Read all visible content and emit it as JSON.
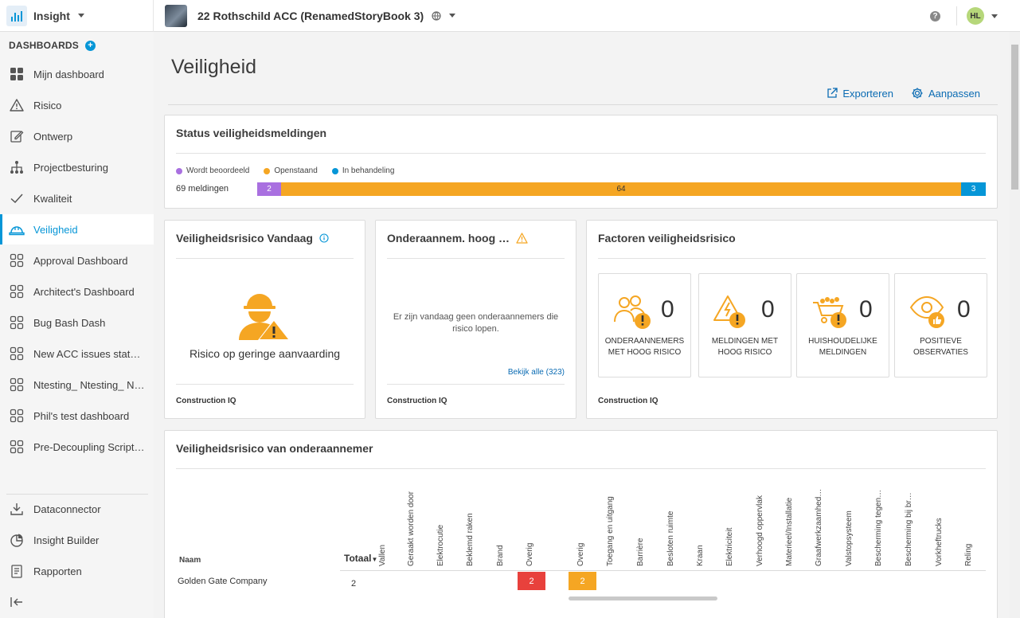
{
  "app": {
    "name": "Insight"
  },
  "project": {
    "name": "22 Rothschild ACC (RenamedStoryBook 3)"
  },
  "user": {
    "initials": "HL"
  },
  "sidebar": {
    "header": "DASHBOARDS",
    "items": [
      {
        "label": "Mijn dashboard"
      },
      {
        "label": "Risico"
      },
      {
        "label": "Ontwerp"
      },
      {
        "label": "Projectbesturing"
      },
      {
        "label": "Kwaliteit"
      },
      {
        "label": "Veiligheid"
      },
      {
        "label": "Approval Dashboard"
      },
      {
        "label": "Architect's Dashboard"
      },
      {
        "label": "Bug Bash Dash"
      },
      {
        "label": "New ACC issues status…"
      },
      {
        "label": "Ntesting_ Ntesting_ N…"
      },
      {
        "label": "Phil's test dashboard"
      },
      {
        "label": "Pre-Decoupling Script …"
      }
    ],
    "bottom": [
      {
        "label": "Dataconnector"
      },
      {
        "label": "Insight Builder"
      },
      {
        "label": "Rapporten"
      }
    ]
  },
  "page": {
    "title": "Veiligheid",
    "export_label": "Exporteren",
    "customize_label": "Aanpassen"
  },
  "status_card": {
    "title": "Status veiligheidsmeldingen",
    "legend": [
      {
        "label": "Wordt beoordeeld",
        "color": "#a970e0"
      },
      {
        "label": "Openstaand",
        "color": "#f5a623"
      },
      {
        "label": "In behandeling",
        "color": "#0696d7"
      }
    ],
    "row_label": "69 meldingen",
    "segments": [
      {
        "value": 2,
        "label": "2",
        "color": "#a970e0",
        "text_color": "#ffffff"
      },
      {
        "value": 64,
        "label": "64",
        "color": "#f5a623",
        "text_color": "#333333"
      },
      {
        "value": 3,
        "label": "3",
        "color": "#0696d7",
        "text_color": "#ffffff"
      }
    ]
  },
  "risk_today": {
    "title": "Veiligheidsrisico Vandaag",
    "level_text": "Risico op geringe aanvaarding",
    "footer": "Construction IQ"
  },
  "subcontractor_high": {
    "title": "Onderaannem. hoog …",
    "message": "Er zijn vandaag geen onderaannemers die risico lopen.",
    "link": "Bekijk alle (323)",
    "footer": "Construction IQ"
  },
  "factors": {
    "title": "Factoren veiligheidsrisico",
    "items": [
      {
        "value": "0",
        "label": "ONDERAANNEMERS MET HOOG RISICO"
      },
      {
        "value": "0",
        "label": "MELDINGEN MET HOOG RISICO"
      },
      {
        "value": "0",
        "label": "HUISHOUDELIJKE MELDINGEN"
      },
      {
        "value": "0",
        "label": "POSITIEVE OBSERVATIES"
      }
    ],
    "footer": "Construction IQ"
  },
  "sub_risk_table": {
    "title": "Veiligheidsrisico van onderaannemer",
    "name_header": "Naam",
    "total_header": "Totaal",
    "columns": [
      "Vallen",
      "Geraakt worden door",
      "Elektrocutie",
      "Beklemd raken",
      "Brand",
      "Overig",
      "Overig",
      "Toegang en uitgang",
      "Barrière",
      "Besloten ruimte",
      "Kraan",
      "Elektriciteit",
      "Verhoogd oppervlak",
      "Materieel/Installatie",
      "Graafwerkzaamhed…",
      "Valstopsysteem",
      "Bescherming tegen…",
      "Bescherming bij br…",
      "Vorkheftrucks",
      "Reling"
    ],
    "rows": [
      {
        "name": "Golden Gate Company",
        "total": "2",
        "cells": [
          {
            "col": 5,
            "value": "2",
            "color": "#e8413c"
          },
          {
            "col": 6,
            "value": "2",
            "color": "#f5a623"
          }
        ]
      }
    ]
  }
}
